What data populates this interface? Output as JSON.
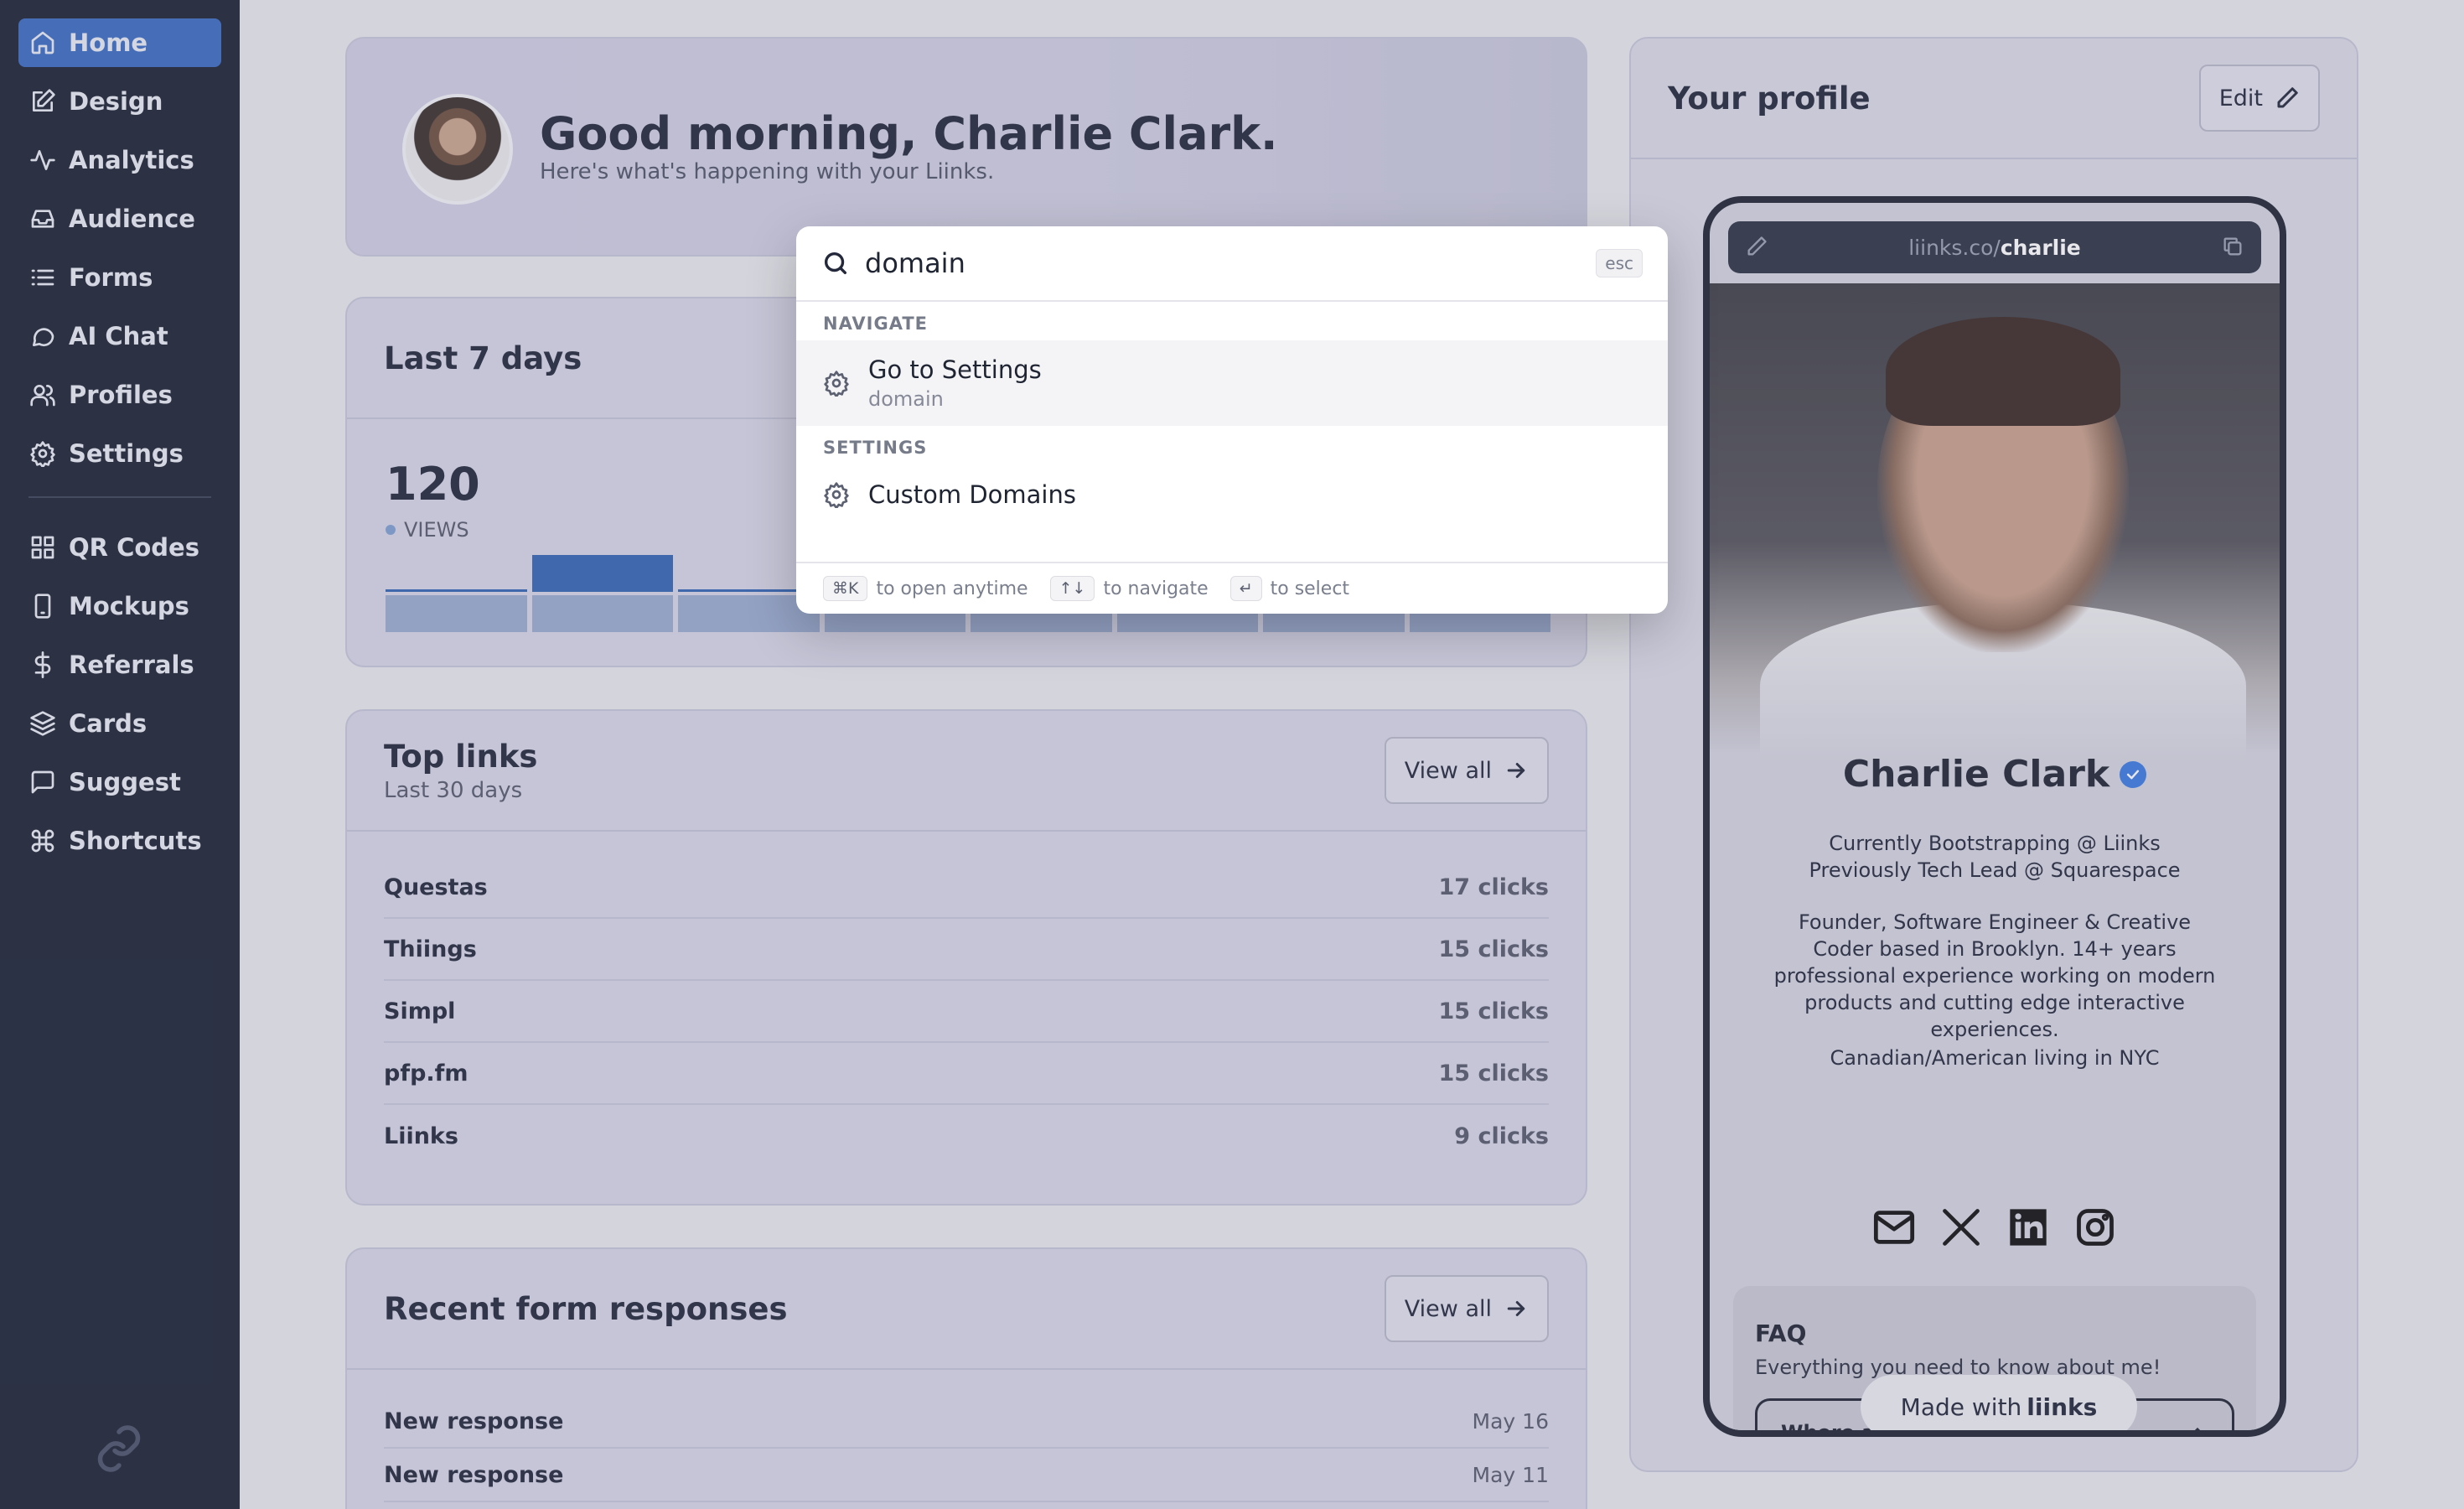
{
  "sidebar": {
    "items": [
      {
        "label": "Home",
        "icon": "home-icon",
        "active": true
      },
      {
        "label": "Design",
        "icon": "edit-square-icon"
      },
      {
        "label": "Analytics",
        "icon": "activity-icon"
      },
      {
        "label": "Audience",
        "icon": "inbox-icon"
      },
      {
        "label": "Forms",
        "icon": "list-icon"
      },
      {
        "label": "AI Chat",
        "icon": "chat-bubble-icon"
      },
      {
        "label": "Profiles",
        "icon": "users-icon"
      },
      {
        "label": "Settings",
        "icon": "gear-icon"
      },
      {
        "label": "QR Codes",
        "icon": "grid-icon"
      },
      {
        "label": "Mockups",
        "icon": "phone-icon"
      },
      {
        "label": "Referrals",
        "icon": "dollar-icon"
      },
      {
        "label": "Cards",
        "icon": "layers-icon"
      },
      {
        "label": "Suggest",
        "icon": "message-square-icon"
      },
      {
        "label": "Shortcuts",
        "icon": "command-icon"
      }
    ]
  },
  "greeting": {
    "title": "Good morning, Charlie Clark.",
    "subtitle": "Here's what's happening with your Liinks."
  },
  "stats": {
    "title": "Last 7 days",
    "value": "120",
    "label": "VIEWS"
  },
  "chart_data": {
    "type": "bar",
    "series": [
      {
        "values": [
          20,
          40,
          2,
          0,
          0,
          0,
          0,
          0
        ]
      },
      {
        "values": [
          20,
          20,
          20,
          10,
          10,
          10,
          10,
          10
        ]
      }
    ],
    "ylim": [
      0,
      40
    ]
  },
  "toplinks": {
    "title": "Top links",
    "subtitle": "Last 30 days",
    "view_all": "View all",
    "rows": [
      {
        "name": "Questas",
        "value": "17 clicks"
      },
      {
        "name": "Thiings",
        "value": "15 clicks"
      },
      {
        "name": "Simpl",
        "value": "15 clicks"
      },
      {
        "name": "pfp.fm",
        "value": "15 clicks"
      },
      {
        "name": "Liinks",
        "value": "9 clicks"
      }
    ]
  },
  "forms": {
    "title": "Recent form responses",
    "view_all": "View all",
    "rows": [
      {
        "name": "New response",
        "date": "May 16"
      },
      {
        "name": "New response",
        "date": "May 11"
      }
    ]
  },
  "profile": {
    "title": "Your profile",
    "edit_label": "Edit",
    "url_prefix": "liinks.co/",
    "url_handle": "charlie",
    "name": "Charlie Clark",
    "bio1": "Currently Bootstrapping @ Liinks",
    "bio2": "Previously Tech Lead @ Squarespace",
    "bio3": "Founder, Software Engineer & Creative Coder based in Brooklyn. 14+ years professional experience working on modern products and cutting edge interactive experiences.",
    "bio4": "Canadian/American living in NYC",
    "faq_title": "FAQ",
    "faq_desc": "Everything you need to know about me!",
    "faq_question": "Where a",
    "made_with": "Made with",
    "made_brand": "liinks"
  },
  "palette": {
    "query": "domain",
    "esc": "esc",
    "section_navigate": "NAVIGATE",
    "item1_label": "Go to Settings",
    "item1_hint": "domain",
    "section_settings": "SETTINGS",
    "item2_label": "Custom Domains",
    "foot_k1": "⌘K",
    "foot_t1": "to open anytime",
    "foot_k2": "↑↓",
    "foot_t2": "to navigate",
    "foot_k3": "↵",
    "foot_t3": "to select"
  }
}
